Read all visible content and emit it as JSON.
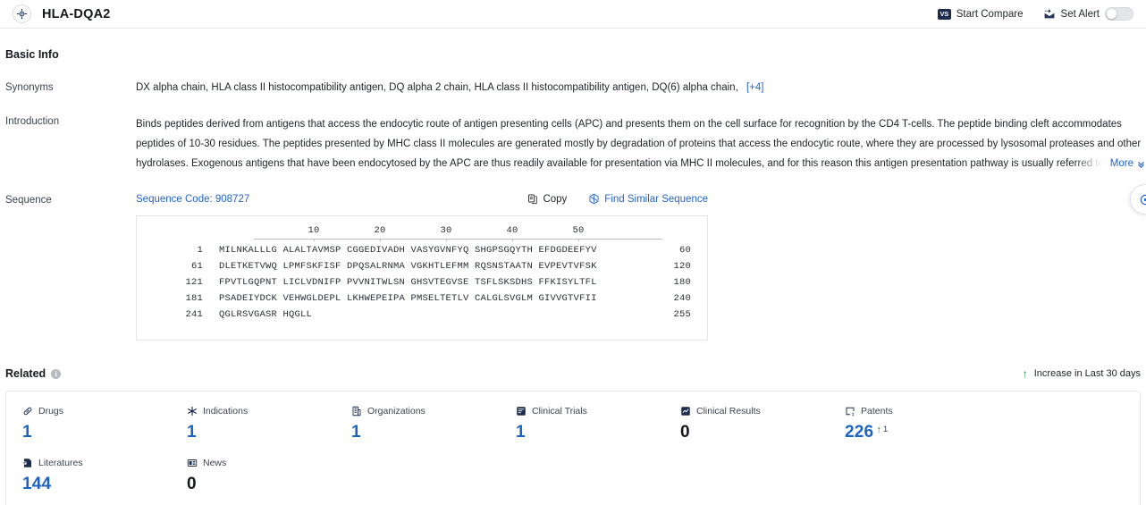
{
  "header": {
    "gene_title": "HLA-DQA2",
    "gene_icon": "target-icon",
    "start_compare_label": "Start Compare",
    "vs_badge": "VS",
    "set_alert_label": "Set Alert",
    "alert_toggle_state": "off"
  },
  "basic_info": {
    "title": "Basic Info",
    "synonyms_label": "Synonyms",
    "synonyms": [
      "DX alpha chain",
      "HLA class II histocompatibility antigen, DQ alpha 2 chain",
      "HLA class II histocompatibility antigen, DQ(6) alpha chain"
    ],
    "synonyms_more": "[+4]",
    "introduction_label": "Introduction",
    "introduction_text": "Binds peptides derived from antigens that access the endocytic route of antigen presenting cells (APC) and presents them on the cell surface for recognition by the CD4 T-cells. The peptide binding cleft accommodates peptides of 10-30 residues. The peptides presented by MHC class II molecules are generated mostly by degradation of proteins that access the endocytic route, where they are processed by lysosomal proteases and other hydrolases. Exogenous antigens that have been endocytosed by the APC are thus readily available for presentation via MHC II molecules, and for this reason this antigen presentation pathway is usually referred to as",
    "more_label": "More"
  },
  "sequence": {
    "label": "Sequence",
    "code_label": "Sequence Code: 908727",
    "copy_label": "Copy",
    "find_similar_label": "Find Similar Sequence",
    "ruler_ticks": [
      10,
      20,
      30,
      40,
      50
    ],
    "lines": [
      {
        "start": "1",
        "residues": "MILNKALLLG ALALTAVMSP CGGEDIVADH VASYGVNFYQ SHGPSGQYTH EFDGDEEFYV",
        "end": "60"
      },
      {
        "start": "61",
        "residues": "DLETKETVWQ LPMFSKFISF DPQSALRNMA VGKHTLEFMM RQSNSTAATN EVPEVTVFSK",
        "end": "120"
      },
      {
        "start": "121",
        "residues": "FPVTLGQPNT LICLVDNIFP PVVNITWLSN GHSVTEGVSE TSFLSKSDHS FFKISYLTFL",
        "end": "180"
      },
      {
        "start": "181",
        "residues": "PSADEIYDCK VEHWGLDEPL LKHWEPEIPA PMSELTETLV CALGLSVGLM GIVVGTVFII",
        "end": "240"
      },
      {
        "start": "241",
        "residues": "QGLRSVGASR HQGLL",
        "end": "255"
      }
    ]
  },
  "related": {
    "title": "Related",
    "info_glyph": "i",
    "legend_label": "Increase in Last 30 days",
    "legend_arrow": "↑",
    "stats": [
      {
        "label": "Drugs",
        "icon": "capsule-icon",
        "value": "1",
        "zero": false,
        "delta": ""
      },
      {
        "label": "Indications",
        "icon": "asterisk-icon",
        "value": "1",
        "zero": false,
        "delta": ""
      },
      {
        "label": "Organizations",
        "icon": "building-icon",
        "value": "1",
        "zero": false,
        "delta": ""
      },
      {
        "label": "Clinical Trials",
        "icon": "clinical-trial-icon",
        "value": "1",
        "zero": false,
        "delta": ""
      },
      {
        "label": "Clinical Results",
        "icon": "clinical-result-icon",
        "value": "0",
        "zero": true,
        "delta": ""
      },
      {
        "label": "Patents",
        "icon": "patent-icon",
        "value": "226",
        "zero": false,
        "delta": "1"
      },
      {
        "label": "Literatures",
        "icon": "literature-icon",
        "value": "144",
        "zero": false,
        "delta": ""
      },
      {
        "label": "News",
        "icon": "news-icon",
        "value": "0",
        "zero": true,
        "delta": ""
      }
    ]
  },
  "colors": {
    "link_blue": "#2565c7",
    "stat_blue": "#1d63c4",
    "increase_green": "#1e8a3c",
    "border": "#e4e6e9"
  }
}
